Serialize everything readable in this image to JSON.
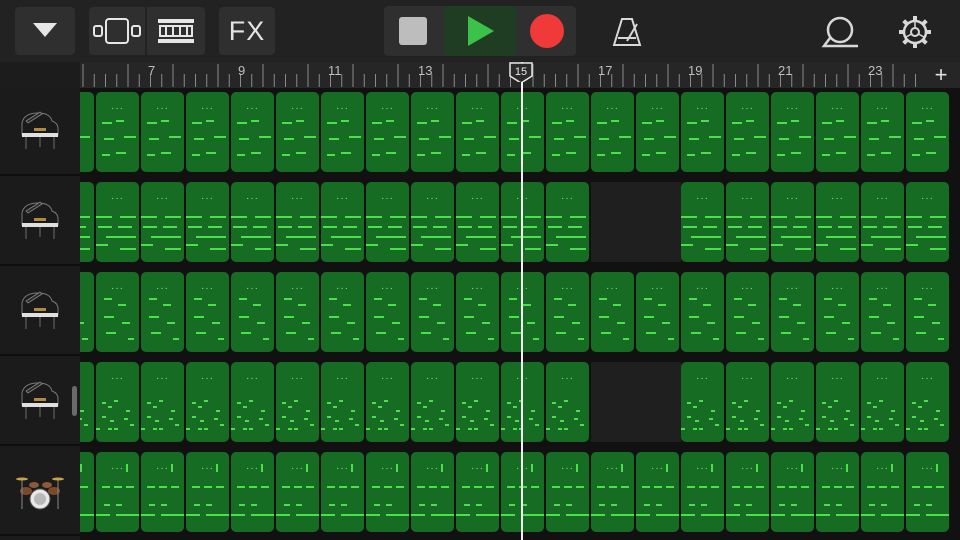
{
  "toolbar": {
    "fx_label": "FX",
    "icons": {
      "tracks_menu": "chevron-down-icon",
      "view": "tracks-view-icon",
      "smart_controls": "smart-controls-icon",
      "stop": "stop-icon",
      "play": "play-icon",
      "record": "record-icon",
      "metronome": "metronome-icon",
      "loops": "loop-browser-icon",
      "settings": "settings-gear-icon"
    },
    "colors": {
      "play": "#3cc24b",
      "record": "#f03a3a",
      "stop": "#bdbdbd"
    }
  },
  "ruler": {
    "bar_numbers": [
      "7",
      "9",
      "11",
      "13",
      "15",
      "17",
      "19",
      "21",
      "23"
    ],
    "add_label": "+",
    "playhead_bar": "15"
  },
  "tracks": [
    {
      "instrument": "grand-piano-icon"
    },
    {
      "instrument": "grand-piano-icon"
    },
    {
      "instrument": "grand-piano-icon"
    },
    {
      "instrument": "grand-piano-icon"
    },
    {
      "instrument": "drum-kit-icon"
    }
  ],
  "colors": {
    "region": "#176c24",
    "note": "#4be04b",
    "background": "#111111"
  }
}
